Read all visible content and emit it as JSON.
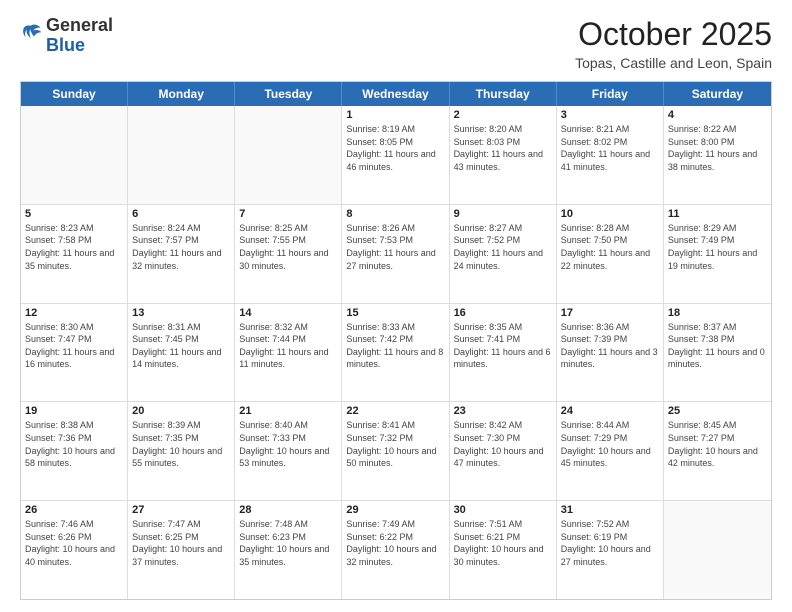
{
  "header": {
    "logo": {
      "line1": "General",
      "line2": "Blue"
    },
    "title": "October 2025",
    "location": "Topas, Castille and Leon, Spain"
  },
  "calendar": {
    "days": [
      "Sunday",
      "Monday",
      "Tuesday",
      "Wednesday",
      "Thursday",
      "Friday",
      "Saturday"
    ],
    "weeks": [
      [
        {
          "day": "",
          "info": ""
        },
        {
          "day": "",
          "info": ""
        },
        {
          "day": "",
          "info": ""
        },
        {
          "day": "1",
          "info": "Sunrise: 8:19 AM\nSunset: 8:05 PM\nDaylight: 11 hours and 46 minutes."
        },
        {
          "day": "2",
          "info": "Sunrise: 8:20 AM\nSunset: 8:03 PM\nDaylight: 11 hours and 43 minutes."
        },
        {
          "day": "3",
          "info": "Sunrise: 8:21 AM\nSunset: 8:02 PM\nDaylight: 11 hours and 41 minutes."
        },
        {
          "day": "4",
          "info": "Sunrise: 8:22 AM\nSunset: 8:00 PM\nDaylight: 11 hours and 38 minutes."
        }
      ],
      [
        {
          "day": "5",
          "info": "Sunrise: 8:23 AM\nSunset: 7:58 PM\nDaylight: 11 hours and 35 minutes."
        },
        {
          "day": "6",
          "info": "Sunrise: 8:24 AM\nSunset: 7:57 PM\nDaylight: 11 hours and 32 minutes."
        },
        {
          "day": "7",
          "info": "Sunrise: 8:25 AM\nSunset: 7:55 PM\nDaylight: 11 hours and 30 minutes."
        },
        {
          "day": "8",
          "info": "Sunrise: 8:26 AM\nSunset: 7:53 PM\nDaylight: 11 hours and 27 minutes."
        },
        {
          "day": "9",
          "info": "Sunrise: 8:27 AM\nSunset: 7:52 PM\nDaylight: 11 hours and 24 minutes."
        },
        {
          "day": "10",
          "info": "Sunrise: 8:28 AM\nSunset: 7:50 PM\nDaylight: 11 hours and 22 minutes."
        },
        {
          "day": "11",
          "info": "Sunrise: 8:29 AM\nSunset: 7:49 PM\nDaylight: 11 hours and 19 minutes."
        }
      ],
      [
        {
          "day": "12",
          "info": "Sunrise: 8:30 AM\nSunset: 7:47 PM\nDaylight: 11 hours and 16 minutes."
        },
        {
          "day": "13",
          "info": "Sunrise: 8:31 AM\nSunset: 7:45 PM\nDaylight: 11 hours and 14 minutes."
        },
        {
          "day": "14",
          "info": "Sunrise: 8:32 AM\nSunset: 7:44 PM\nDaylight: 11 hours and 11 minutes."
        },
        {
          "day": "15",
          "info": "Sunrise: 8:33 AM\nSunset: 7:42 PM\nDaylight: 11 hours and 8 minutes."
        },
        {
          "day": "16",
          "info": "Sunrise: 8:35 AM\nSunset: 7:41 PM\nDaylight: 11 hours and 6 minutes."
        },
        {
          "day": "17",
          "info": "Sunrise: 8:36 AM\nSunset: 7:39 PM\nDaylight: 11 hours and 3 minutes."
        },
        {
          "day": "18",
          "info": "Sunrise: 8:37 AM\nSunset: 7:38 PM\nDaylight: 11 hours and 0 minutes."
        }
      ],
      [
        {
          "day": "19",
          "info": "Sunrise: 8:38 AM\nSunset: 7:36 PM\nDaylight: 10 hours and 58 minutes."
        },
        {
          "day": "20",
          "info": "Sunrise: 8:39 AM\nSunset: 7:35 PM\nDaylight: 10 hours and 55 minutes."
        },
        {
          "day": "21",
          "info": "Sunrise: 8:40 AM\nSunset: 7:33 PM\nDaylight: 10 hours and 53 minutes."
        },
        {
          "day": "22",
          "info": "Sunrise: 8:41 AM\nSunset: 7:32 PM\nDaylight: 10 hours and 50 minutes."
        },
        {
          "day": "23",
          "info": "Sunrise: 8:42 AM\nSunset: 7:30 PM\nDaylight: 10 hours and 47 minutes."
        },
        {
          "day": "24",
          "info": "Sunrise: 8:44 AM\nSunset: 7:29 PM\nDaylight: 10 hours and 45 minutes."
        },
        {
          "day": "25",
          "info": "Sunrise: 8:45 AM\nSunset: 7:27 PM\nDaylight: 10 hours and 42 minutes."
        }
      ],
      [
        {
          "day": "26",
          "info": "Sunrise: 7:46 AM\nSunset: 6:26 PM\nDaylight: 10 hours and 40 minutes."
        },
        {
          "day": "27",
          "info": "Sunrise: 7:47 AM\nSunset: 6:25 PM\nDaylight: 10 hours and 37 minutes."
        },
        {
          "day": "28",
          "info": "Sunrise: 7:48 AM\nSunset: 6:23 PM\nDaylight: 10 hours and 35 minutes."
        },
        {
          "day": "29",
          "info": "Sunrise: 7:49 AM\nSunset: 6:22 PM\nDaylight: 10 hours and 32 minutes."
        },
        {
          "day": "30",
          "info": "Sunrise: 7:51 AM\nSunset: 6:21 PM\nDaylight: 10 hours and 30 minutes."
        },
        {
          "day": "31",
          "info": "Sunrise: 7:52 AM\nSunset: 6:19 PM\nDaylight: 10 hours and 27 minutes."
        },
        {
          "day": "",
          "info": ""
        }
      ]
    ]
  }
}
